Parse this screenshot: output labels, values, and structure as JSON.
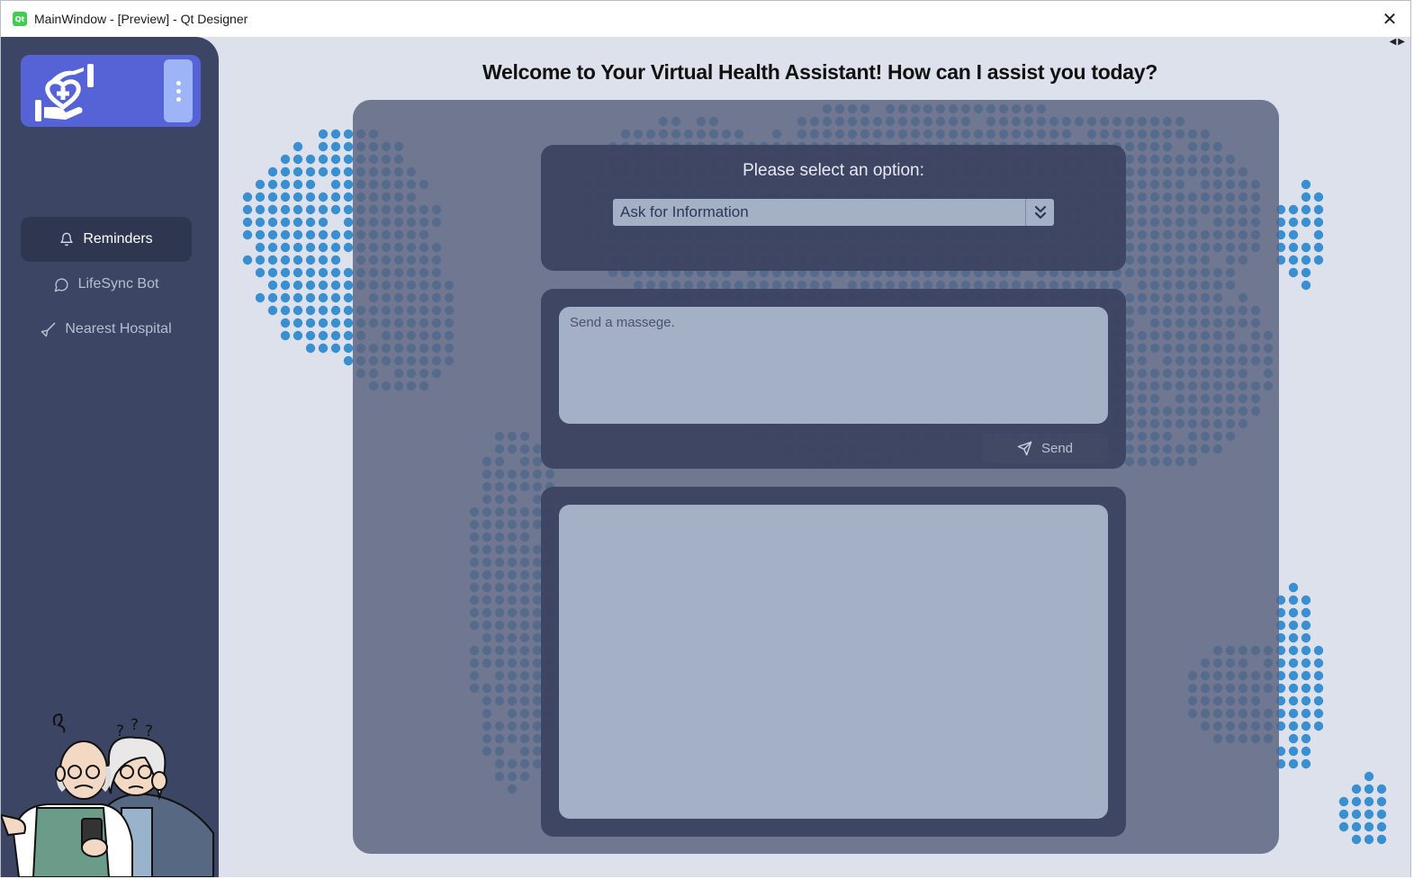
{
  "window": {
    "title": "MainWindow - [Preview] - Qt Designer",
    "app_icon": "Qt",
    "close_glyph": "✕"
  },
  "sidebar": {
    "logo_icon": "hand-heart-care-icon",
    "menu_icon": "vertical-dots-icon",
    "items": [
      {
        "label": "Reminders",
        "icon": "bell-icon",
        "active": true
      },
      {
        "label": "LifeSync Bot",
        "icon": "chat-bubble-icon",
        "active": false
      },
      {
        "label": "Nearest Hospital",
        "icon": "navigation-arrow-icon",
        "active": false
      }
    ],
    "illustration": "confused-elderly-couple-with-phone"
  },
  "main": {
    "heading": "Welcome to Your Virtual Health Assistant! How can I assist you today?",
    "option_label": "Please select an option:",
    "option_selected": "Ask for Information",
    "message_placeholder": "Send a massege.",
    "send_label": "Send",
    "background": "dotted-world-map"
  },
  "colors": {
    "sidebar": "#3c4563",
    "logo_card": "#5563d6",
    "menu_toggle": "#9db4f7",
    "panel": "#5c6580",
    "card": "#3b4360",
    "field": "#a4b0c5",
    "map_dot": "#3a8fd0"
  }
}
